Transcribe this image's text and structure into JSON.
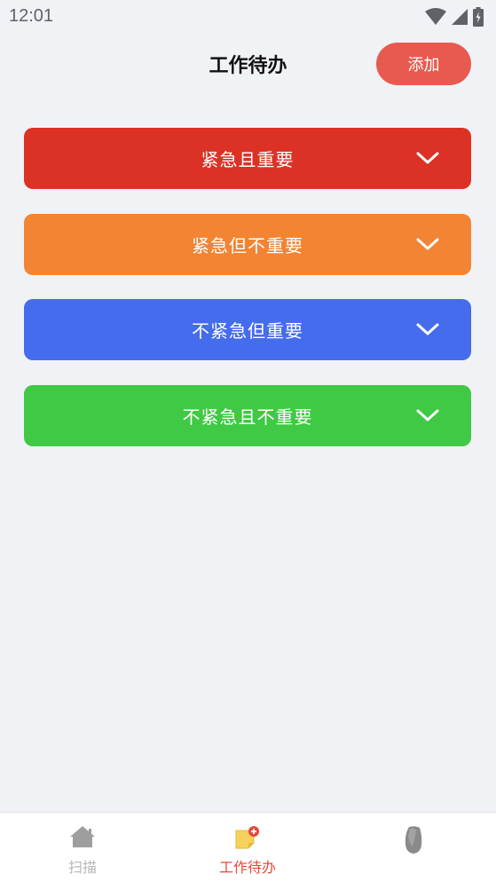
{
  "status_bar": {
    "time": "12:01"
  },
  "header": {
    "title": "工作待办",
    "add_label": "添加"
  },
  "categories": [
    {
      "label": "紧急且重要",
      "color": "#dc3226"
    },
    {
      "label": "紧急但不重要",
      "color": "#f28433"
    },
    {
      "label": "不紧急但重要",
      "color": "#456ced"
    },
    {
      "label": "不紧急且不重要",
      "color": "#3fc945"
    }
  ],
  "tabs": [
    {
      "label": "扫描",
      "icon": "home-icon",
      "active": false
    },
    {
      "label": "工作待办",
      "icon": "note-add-icon",
      "active": true
    },
    {
      "label": "",
      "icon": "stone-icon",
      "active": false
    }
  ],
  "colors": {
    "active_tab": "#e8483c",
    "inactive_tab": "#b8b8b8",
    "accent": "#e85a4f"
  }
}
